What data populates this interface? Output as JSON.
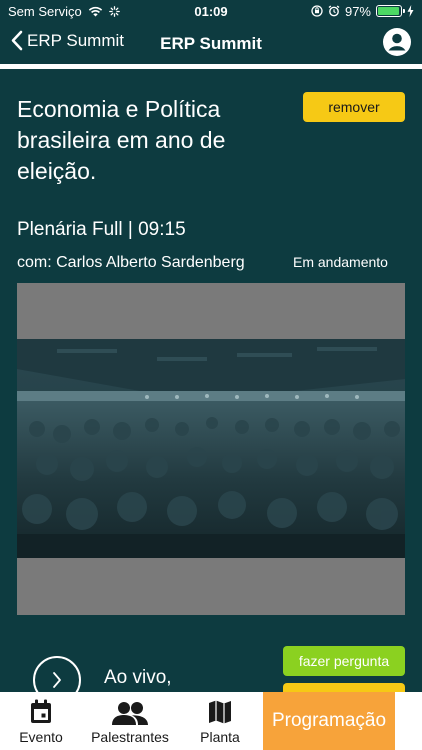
{
  "status_bar": {
    "carrier": "Sem Serviço",
    "time": "01:09",
    "battery": "97%",
    "battery_level": 0.97
  },
  "nav": {
    "back_label": "ERP Summit",
    "title": "ERP Summit"
  },
  "session": {
    "title": "Economia e Política brasileira em ano de eleição.",
    "remove_label": "remover",
    "meta": "Plenária Full | 09:15",
    "speaker": "com: Carlos Alberto Sardenberg",
    "status": "Em andamento"
  },
  "actions": {
    "live_label": "Ao vivo,",
    "ask_label": "fazer pergunta"
  },
  "tabs": [
    {
      "label": "Evento",
      "icon": "calendar-icon"
    },
    {
      "label": "Palestrantes",
      "icon": "people-icon"
    },
    {
      "label": "Planta",
      "icon": "map-icon"
    },
    {
      "label": "Programação",
      "icon": ""
    }
  ],
  "colors": {
    "background": "#0d3b40",
    "remove": "#f6c915",
    "ask": "#8bd120",
    "active_tab": "#f7a33a"
  }
}
